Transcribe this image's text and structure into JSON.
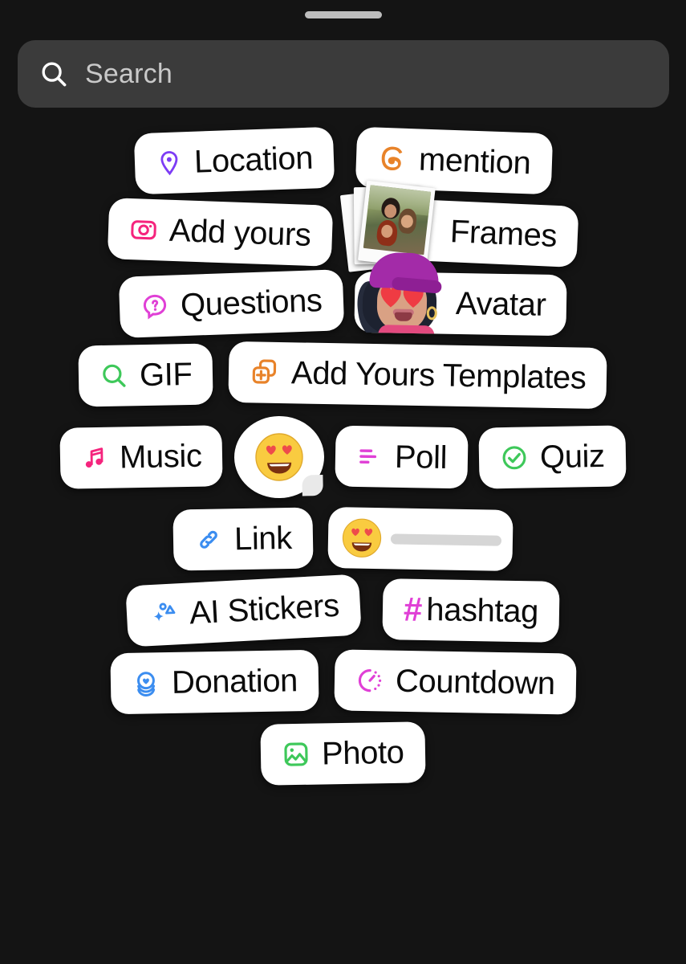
{
  "window": {
    "background_color": "#141414",
    "handle_color": "#bdbdbd"
  },
  "search": {
    "placeholder": "Search",
    "value": "",
    "icon": "search-icon",
    "field_color": "#3b3b3b",
    "placeholder_color": "#c9c9c9"
  },
  "sticker_tray": {
    "rows": [
      {
        "items": [
          {
            "id": "location",
            "label": "Location",
            "icon": "location-pin-icon",
            "icon_color": "#7d3cf5",
            "type": "pill"
          },
          {
            "id": "mention",
            "label": "mention",
            "icon": "threads-logo-icon",
            "icon_color": "#e8832a",
            "type": "pill"
          }
        ]
      },
      {
        "items": [
          {
            "id": "add-yours",
            "label": "Add yours",
            "icon": "camera-icon",
            "icon_color": "#f5247d",
            "type": "pill"
          },
          {
            "id": "frames",
            "label": "Frames",
            "icon": "polaroid-stack-icon",
            "icon_color": "#fbfbfb",
            "type": "media-pill"
          }
        ]
      },
      {
        "items": [
          {
            "id": "questions",
            "label": "Questions",
            "icon": "question-bubble-icon",
            "icon_color": "#e040d6",
            "type": "pill"
          },
          {
            "id": "avatar",
            "label": "Avatar",
            "icon": "avatar-icon",
            "icon_color": "#a32ba8",
            "type": "media-pill"
          }
        ]
      },
      {
        "items": [
          {
            "id": "gif",
            "label": "GIF",
            "icon": "gif-search-icon",
            "icon_color": "#3ec85a",
            "type": "pill"
          },
          {
            "id": "add-yours-templates",
            "label": "Add Yours Templates",
            "icon": "template-plus-icon",
            "icon_color": "#e8832a",
            "type": "pill"
          }
        ]
      },
      {
        "items": [
          {
            "id": "music",
            "label": "Music",
            "icon": "music-note-icon",
            "icon_color": "#f5247d",
            "type": "pill"
          },
          {
            "id": "reaction",
            "label": "",
            "icon": "heart-eyes-emoji",
            "icon_color": "#f7c94b",
            "type": "reaction"
          },
          {
            "id": "poll",
            "label": "Poll",
            "icon": "poll-bars-icon",
            "icon_color": "#e040d6",
            "type": "pill"
          },
          {
            "id": "quiz",
            "label": "Quiz",
            "icon": "check-circle-icon",
            "icon_color": "#3ec85a",
            "type": "pill"
          }
        ]
      },
      {
        "items": [
          {
            "id": "link",
            "label": "Link",
            "icon": "link-chain-icon",
            "icon_color": "#3b8df0",
            "type": "pill"
          },
          {
            "id": "emoji-slider",
            "label": "",
            "icon": "heart-eyes-emoji",
            "icon_color": "#f7c94b",
            "type": "slider",
            "track_color": "#d6d6d6",
            "value": 0
          }
        ]
      },
      {
        "items": [
          {
            "id": "ai-stickers",
            "label": "AI Stickers",
            "icon": "sparkles-icon",
            "icon_color": "#3b8df0",
            "type": "pill"
          },
          {
            "id": "hashtag",
            "label": "hashtag",
            "icon": "hash-symbol",
            "icon_color": "#e040d6",
            "type": "hashtag",
            "symbol": "#"
          }
        ]
      },
      {
        "items": [
          {
            "id": "donation",
            "label": "Donation",
            "icon": "donation-heart-coin-icon",
            "icon_color": "#3b8df0",
            "type": "pill"
          },
          {
            "id": "countdown",
            "label": "Countdown",
            "icon": "countdown-timer-icon",
            "icon_color": "#e040d6",
            "type": "pill"
          }
        ]
      },
      {
        "items": [
          {
            "id": "photo",
            "label": "Photo",
            "icon": "photo-image-icon",
            "icon_color": "#3ec85a",
            "type": "pill"
          }
        ]
      }
    ]
  }
}
